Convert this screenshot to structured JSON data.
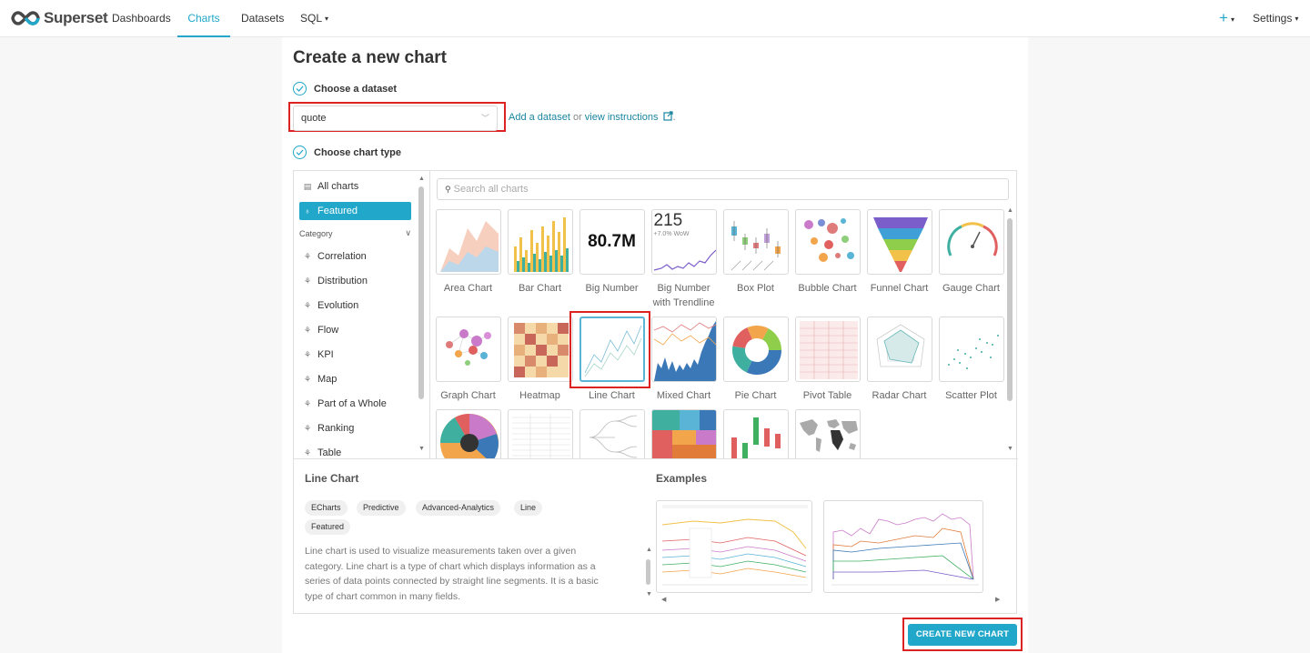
{
  "nav": {
    "logo_text": "Superset",
    "items": [
      "Dashboards",
      "Charts",
      "Datasets",
      "SQL"
    ],
    "plus": "+",
    "settings": "Settings"
  },
  "page": {
    "title": "Create a new chart",
    "step1": "Choose a dataset",
    "step2": "Choose chart type"
  },
  "dataset": {
    "value": "quote",
    "add_link": "Add a dataset",
    "or_text": " or ",
    "instructions_link": "view instructions",
    "period": "."
  },
  "sidebar": {
    "all_charts": "All charts",
    "featured": "Featured",
    "category_label": "Category",
    "categories": [
      "Correlation",
      "Distribution",
      "Evolution",
      "Flow",
      "KPI",
      "Map",
      "Part of a Whole",
      "Ranking",
      "Table"
    ]
  },
  "search": {
    "placeholder": "Search all charts"
  },
  "charts": [
    {
      "name": "Area Chart"
    },
    {
      "name": "Bar Chart"
    },
    {
      "name": "Big Number",
      "thumb_text": "80.7M"
    },
    {
      "name": "Big Number with Trendline",
      "thumb_text": "215",
      "thumb_sub": "+7.0% WoW"
    },
    {
      "name": "Box Plot"
    },
    {
      "name": "Bubble Chart"
    },
    {
      "name": "Funnel Chart"
    },
    {
      "name": "Gauge Chart"
    },
    {
      "name": "Graph Chart"
    },
    {
      "name": "Heatmap"
    },
    {
      "name": "Line Chart"
    },
    {
      "name": "Mixed Chart"
    },
    {
      "name": "Pie Chart"
    },
    {
      "name": "Pivot Table"
    },
    {
      "name": "Radar Chart"
    },
    {
      "name": "Scatter Plot"
    }
  ],
  "selected": {
    "title": "Line Chart",
    "tags": [
      "ECharts",
      "Predictive",
      "Advanced-Analytics",
      "Line",
      "Featured"
    ],
    "description": "Line chart is used to visualize measurements taken over a given category. Line chart is a type of chart which displays information as a series of data points connected by straight line segments. It is a basic type of chart common in many fields.",
    "examples_title": "Examples"
  },
  "create_button": "CREATE NEW CHART",
  "colors": {
    "accent": "#20a7c9",
    "highlight": "#dd2222"
  }
}
